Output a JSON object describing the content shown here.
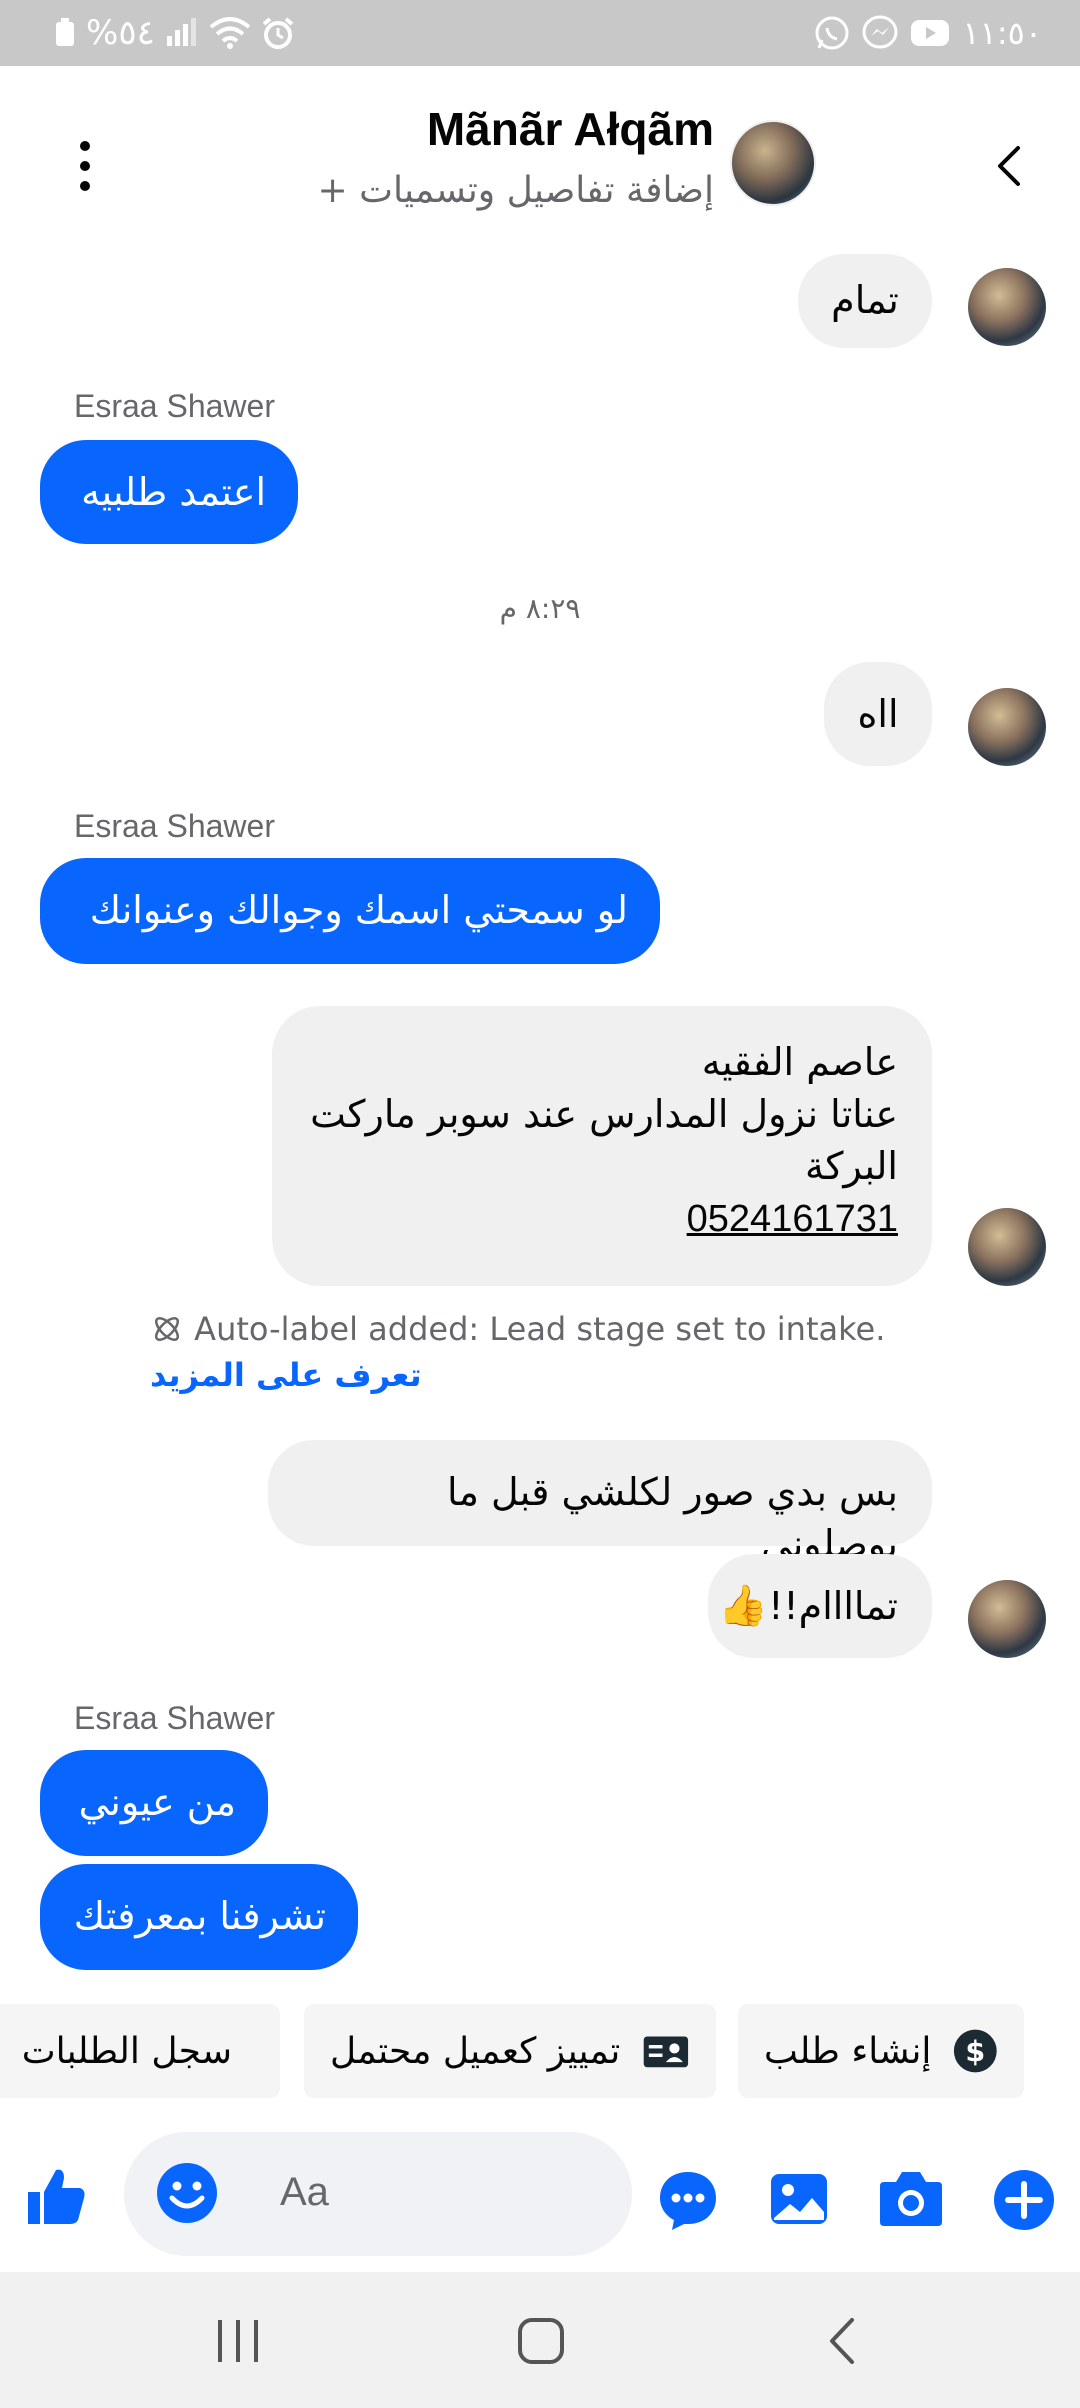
{
  "status_bar": {
    "time": "١١:٥٠",
    "battery": "%٥٤"
  },
  "header": {
    "title": "Mãnãr Ałqãm",
    "subtitle": "+ إضافة تفاصيل وتسميات"
  },
  "messages": {
    "m1": "تمام",
    "sender1": "Esraa Shawer",
    "m2": "اعتمد طلبيه",
    "timestamp": "٨:٢٩ م",
    "m3": "ااه",
    "sender2": "Esraa Shawer",
    "m4": "لو سمحتي اسمك وجوالك وعنوانك",
    "m5_line1": "عاصم الفقيه",
    "m5_line2": "عناتا نزول المدارس  عند سوبر ماركت",
    "m5_line3": "البركة",
    "m5_phone": "0524161731",
    "autolabel_text": "Auto-label added: Lead stage set to intake.",
    "autolabel_link": "تعرف على المزيد",
    "m6": "بس بدي صور لكلشي قبل ما يوصلوني",
    "m7": "تماااام!!",
    "sender3": "Esraa Shawer",
    "m8": "من عيوني",
    "m9": "تشرفنا بمعرفتك"
  },
  "quick_actions": {
    "a1": "إنشاء طلب",
    "a2": "تمييز كعميل محتمل",
    "a3": "سجل الطلبات"
  },
  "composer": {
    "placeholder": "Aa"
  },
  "colors": {
    "accent": "#0866ff",
    "incoming_bubble": "#f0f0f0",
    "status_bar": "#c8c8c8"
  },
  "icons": [
    "back-icon",
    "more-vert-icon",
    "like-icon",
    "emoji-icon",
    "chat-icon",
    "gallery-icon",
    "camera-icon",
    "plus-icon",
    "dollar-icon",
    "contact-card-icon",
    "list-icon",
    "ai-label-icon",
    "recents-icon",
    "home-icon",
    "nav-back-icon"
  ]
}
